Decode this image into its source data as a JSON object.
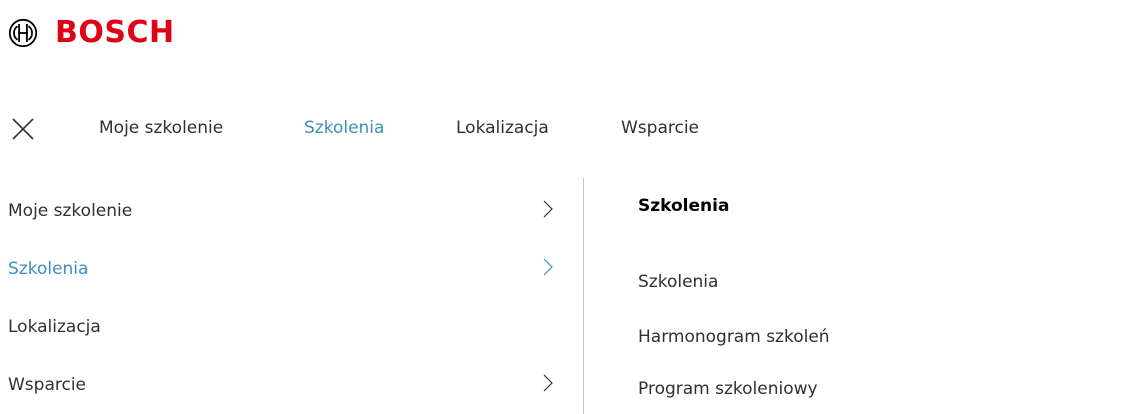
{
  "brand": {
    "name": "BOSCH",
    "color": "#e20015",
    "mark_icon": "bosch-armature-icon"
  },
  "colors": {
    "accent": "#3991bd",
    "text": "#2e3033",
    "divider": "#c1c7cc"
  },
  "topnav": {
    "close_icon": "close-icon",
    "items": [
      {
        "label": "Moje szkolenie",
        "active": false
      },
      {
        "label": "Szkolenia",
        "active": true
      },
      {
        "label": "Lokalizacja",
        "active": false
      },
      {
        "label": "Wsparcie",
        "active": false
      }
    ]
  },
  "leftmenu": {
    "items": [
      {
        "label": "Moje szkolenie",
        "has_submenu": true,
        "active": false
      },
      {
        "label": "Szkolenia",
        "has_submenu": true,
        "active": true
      },
      {
        "label": "Lokalizacja",
        "has_submenu": false,
        "active": false
      },
      {
        "label": "Wsparcie",
        "has_submenu": true,
        "active": false
      }
    ],
    "chevron_icon": "chevron-right-icon"
  },
  "submenu": {
    "title": "Szkolenia",
    "links": [
      {
        "label": "Szkolenia"
      },
      {
        "label": "Harmonogram szkoleń"
      },
      {
        "label": "Program szkoleniowy"
      }
    ]
  }
}
